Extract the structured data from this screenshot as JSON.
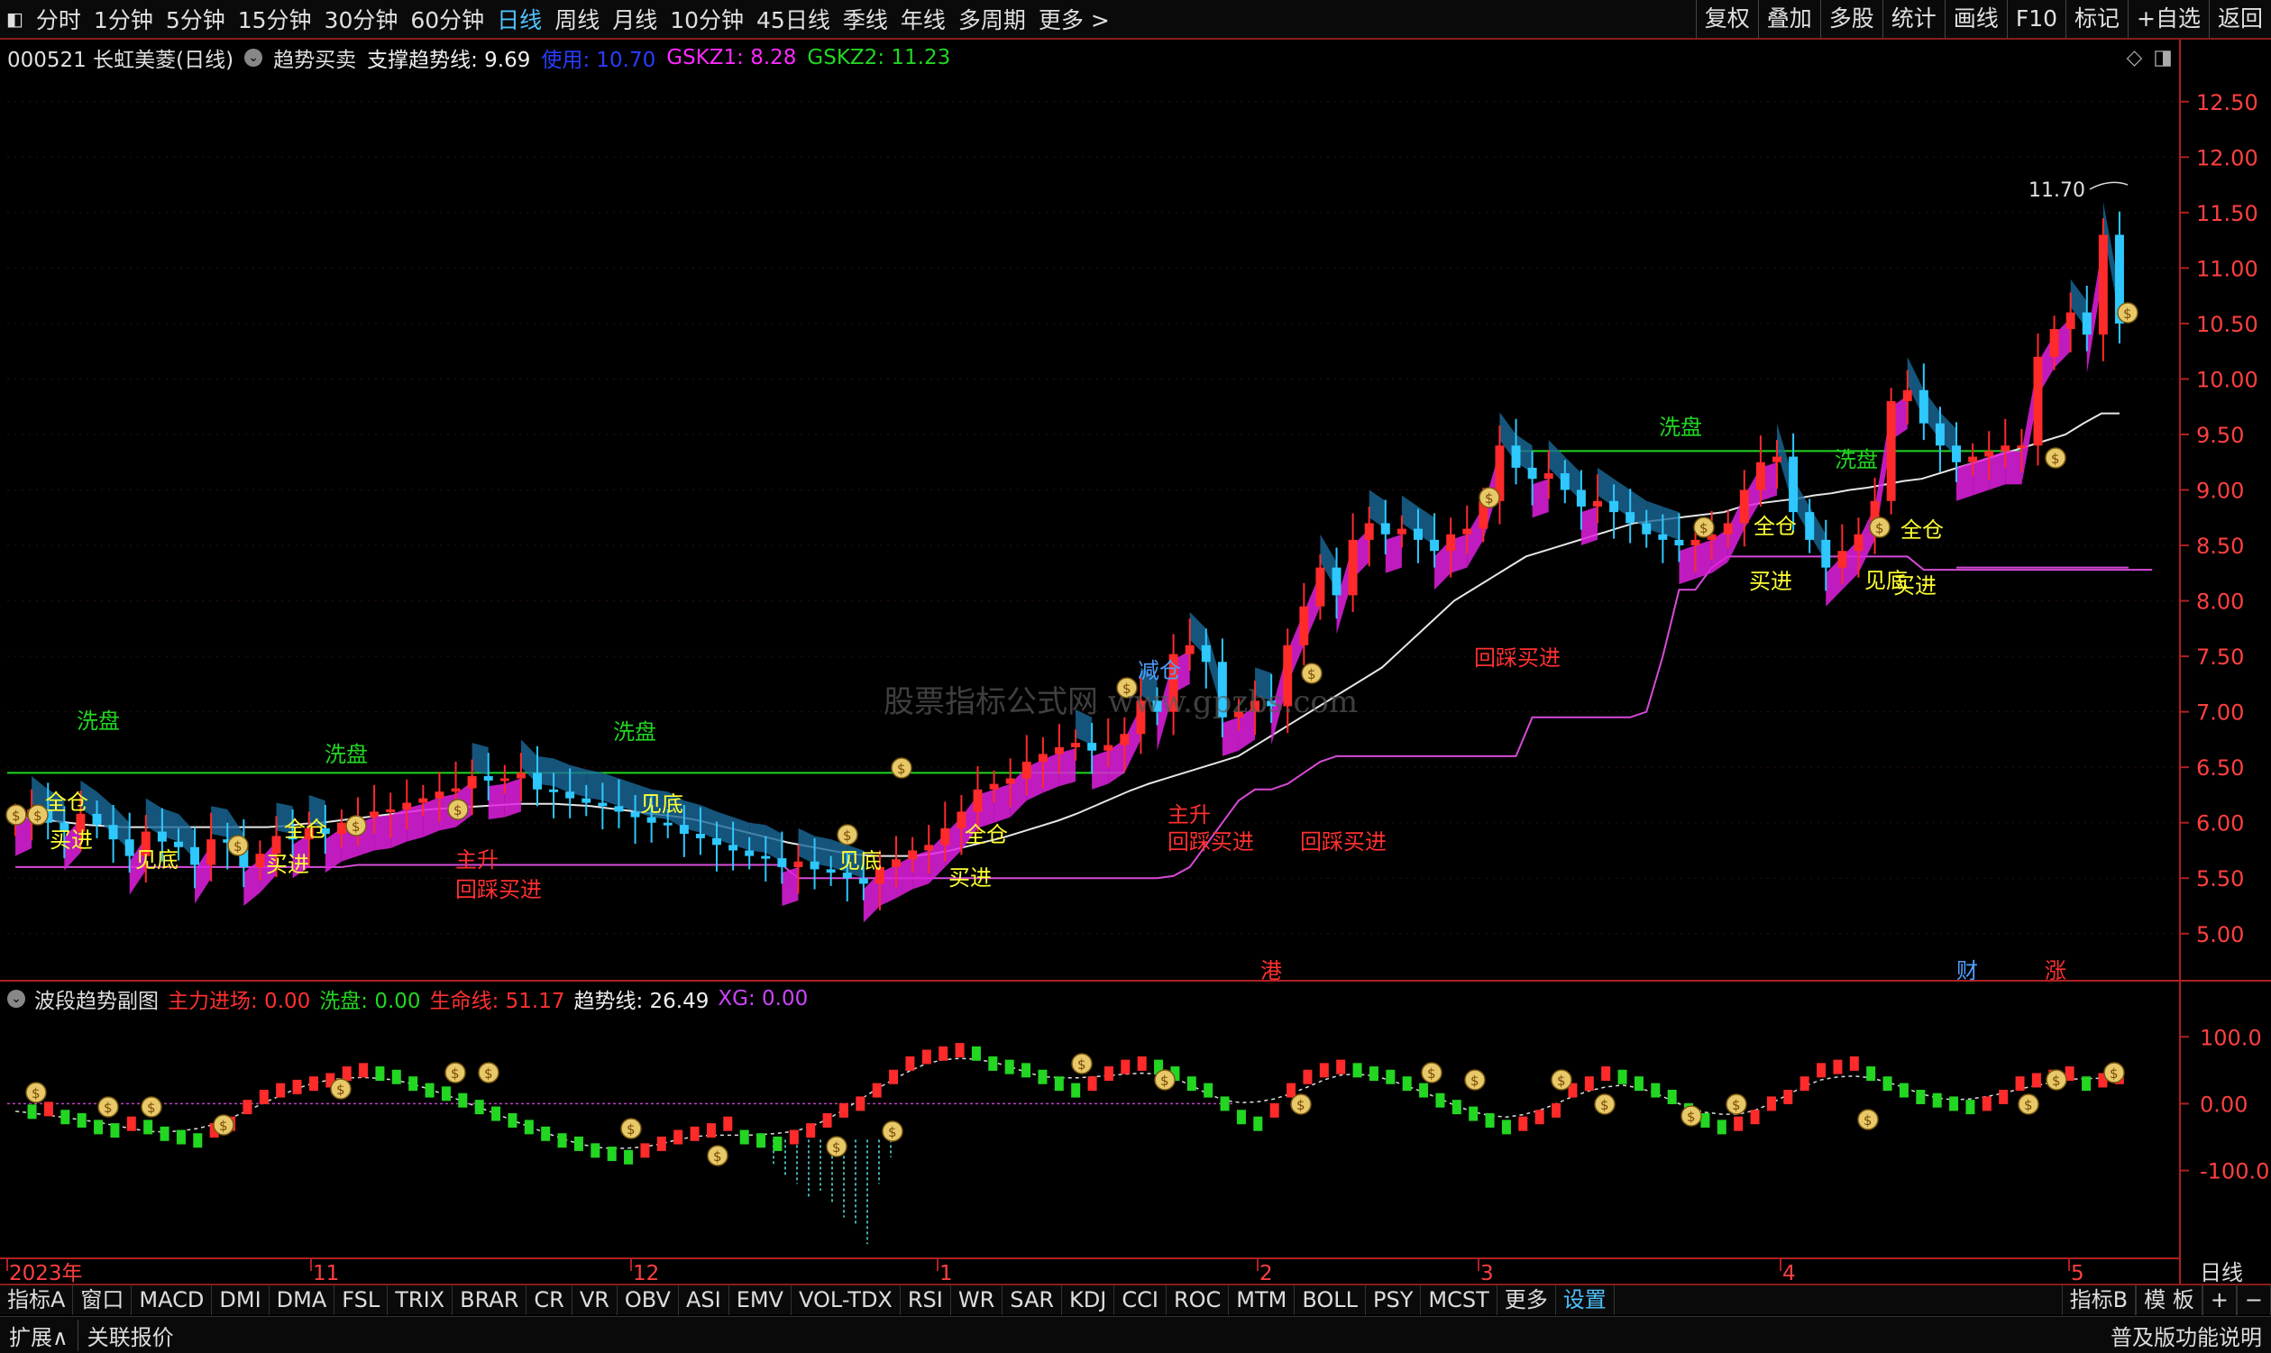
{
  "top_bar": {
    "periods": [
      "分时",
      "1分钟",
      "5分钟",
      "15分钟",
      "30分钟",
      "60分钟",
      "日线",
      "周线",
      "月线",
      "10分钟",
      "45日线",
      "季线",
      "年线",
      "多周期",
      "更多 >"
    ],
    "active": "日线",
    "tools": [
      "复权",
      "叠加",
      "多股",
      "统计",
      "画线",
      "F10",
      "标记",
      "+自选",
      "返回"
    ]
  },
  "info": {
    "stock": "000521 长虹美菱(日线)",
    "indicator": "趋势买卖",
    "support_label": "支撑趋势线: 9.69",
    "use_label": "使用: 10.70",
    "gskz1": "GSKZ1: 8.28",
    "gskz2": "GSKZ2: 11.23"
  },
  "sub_info": {
    "name": "波段趋势副图",
    "zljc": "主力进场: 0.00",
    "xp": "洗盘: 0.00",
    "smx": "生命线: 51.17",
    "qsx": "趋势线: 26.49",
    "xg": "XG: 0.00"
  },
  "colors": {
    "up": "#ff2a2a",
    "down": "#2ec8ff",
    "support": "#d84bd8",
    "ma": "#e6e6e6",
    "green": "#22d622",
    "magenta": "#ff2aff",
    "yellow": "#ffff33",
    "red_text": "#ff3030"
  },
  "watermark": "股票指标公式网 www.gpzbs.com",
  "ind_bar": {
    "items": [
      "指标A",
      "窗口",
      "MACD",
      "DMI",
      "DMA",
      "FSL",
      "TRIX",
      "BRAR",
      "CR",
      "VR",
      "OBV",
      "ASI",
      "EMV",
      "VOL-TDX",
      "RSI",
      "WR",
      "SAR",
      "KDJ",
      "CCI",
      "ROC",
      "MTM",
      "BOLL",
      "PSY",
      "MCST",
      "更多",
      "设置"
    ],
    "active": "设置",
    "right": [
      "指标B",
      "模 板",
      "+",
      "−"
    ],
    "period_tag": "日线"
  },
  "bottom_bar": {
    "left": [
      "扩展∧",
      "关联报价"
    ],
    "right": "普及版功能说明"
  },
  "chart_data": [
    {
      "type": "candlestick",
      "title": "000521 长虹美菱(日线)",
      "ylim": [
        4.6,
        12.75
      ],
      "y_ticks": [
        "12.50",
        "12.00",
        "11.50",
        "11.00",
        "10.50",
        "10.00",
        "9.50",
        "9.00",
        "8.50",
        "8.00",
        "7.50",
        "7.00",
        "6.50",
        "6.00",
        "5.50",
        "5.00"
      ],
      "x_ticks": [
        "2023年",
        "11",
        "12",
        "1",
        "2",
        "3",
        "4",
        "5"
      ],
      "close": [
        6.05,
        6.12,
        6.0,
        5.92,
        6.08,
        5.98,
        5.85,
        5.7,
        5.92,
        5.83,
        5.78,
        5.62,
        5.85,
        5.82,
        5.6,
        5.72,
        5.88,
        5.85,
        5.95,
        5.9,
        6.0,
        6.05,
        6.1,
        6.12,
        6.18,
        6.22,
        6.28,
        6.31,
        6.42,
        6.38,
        6.4,
        6.45,
        6.3,
        6.28,
        6.22,
        6.18,
        6.15,
        6.1,
        6.05,
        6.0,
        5.98,
        5.9,
        5.86,
        5.8,
        5.75,
        5.7,
        5.68,
        5.6,
        5.65,
        5.58,
        5.55,
        5.5,
        5.45,
        5.6,
        5.67,
        5.75,
        5.8,
        5.95,
        6.1,
        6.3,
        6.35,
        6.4,
        6.55,
        6.62,
        6.68,
        6.72,
        6.65,
        6.7,
        6.8,
        7.1,
        7.0,
        7.52,
        7.6,
        7.45,
        6.95,
        7.0,
        7.1,
        7.05,
        7.6,
        7.95,
        8.3,
        8.05,
        8.55,
        8.7,
        8.6,
        8.65,
        8.55,
        8.45,
        8.6,
        8.65,
        8.9,
        9.4,
        9.2,
        9.1,
        9.15,
        9.0,
        8.85,
        8.9,
        8.8,
        8.7,
        8.6,
        8.55,
        8.5,
        8.55,
        8.6,
        8.7,
        9.0,
        9.25,
        9.3,
        8.8,
        8.55,
        8.3,
        8.45,
        8.6,
        8.9,
        9.8,
        9.9,
        9.6,
        9.4,
        9.25,
        9.3,
        9.35,
        9.4,
        9.4,
        10.2,
        10.45,
        10.6,
        10.4,
        11.3,
        10.5
      ],
      "support_line": [
        5.6,
        5.6,
        5.6,
        5.6,
        5.6,
        5.6,
        5.6,
        5.6,
        5.6,
        5.6,
        5.6,
        5.6,
        5.6,
        5.6,
        5.6,
        5.6,
        5.6,
        5.6,
        5.6,
        5.6,
        5.6,
        5.62,
        5.62,
        5.62,
        5.62,
        5.62,
        5.62,
        5.62,
        5.62,
        5.62,
        5.62,
        5.62,
        5.62,
        5.62,
        5.62,
        5.62,
        5.62,
        5.62,
        5.62,
        5.62,
        5.62,
        5.62,
        5.62,
        5.62,
        5.62,
        5.62,
        5.62,
        5.62,
        5.5,
        5.5,
        5.5,
        5.5,
        5.5,
        5.5,
        5.5,
        5.5,
        5.5,
        5.5,
        5.5,
        5.5,
        5.5,
        5.5,
        5.5,
        5.5,
        5.5,
        5.5,
        5.5,
        5.5,
        5.5,
        5.5,
        5.5,
        5.52,
        5.6,
        5.8,
        6.0,
        6.2,
        6.3,
        6.3,
        6.35,
        6.45,
        6.55,
        6.6,
        6.6,
        6.6,
        6.6,
        6.6,
        6.6,
        6.6,
        6.6,
        6.6,
        6.6,
        6.6,
        6.6,
        6.95,
        6.95,
        6.95,
        6.95,
        6.95,
        6.95,
        6.95,
        7.0,
        7.5,
        8.1,
        8.1,
        8.3,
        8.4,
        8.4,
        8.4,
        8.4,
        8.4,
        8.4,
        8.4,
        8.4,
        8.4,
        8.4,
        8.4,
        8.4,
        8.28,
        8.28,
        8.28,
        8.28,
        8.28,
        8.28,
        8.28,
        8.28,
        8.28,
        8.28,
        8.28,
        8.28,
        8.28,
        8.28,
        8.28
      ],
      "ma_line": [
        6.05,
        6.04,
        6.02,
        6.0,
        5.98,
        5.97,
        5.96,
        5.96,
        5.96,
        5.96,
        5.96,
        5.96,
        5.96,
        5.96,
        5.96,
        5.97,
        5.99,
        6.0,
        6.02,
        6.04,
        6.06,
        6.08,
        6.1,
        6.12,
        6.13,
        6.14,
        6.15,
        6.16,
        6.17,
        6.17,
        6.17,
        6.16,
        6.15,
        6.13,
        6.11,
        6.09,
        6.07,
        6.05,
        6.02,
        5.98,
        5.94,
        5.9,
        5.86,
        5.82,
        5.79,
        5.76,
        5.73,
        5.71,
        5.7,
        5.7,
        5.7,
        5.72,
        5.75,
        5.79,
        5.83,
        5.87,
        5.92,
        5.97,
        6.02,
        6.08,
        6.15,
        6.22,
        6.29,
        6.35,
        6.4,
        6.45,
        6.5,
        6.55,
        6.6,
        6.7,
        6.8,
        6.9,
        7.0,
        7.1,
        7.2,
        7.3,
        7.4,
        7.55,
        7.7,
        7.85,
        8.0,
        8.1,
        8.2,
        8.3,
        8.4,
        8.45,
        8.5,
        8.55,
        8.6,
        8.65,
        8.7,
        8.72,
        8.74,
        8.76,
        8.78,
        8.8,
        8.85,
        8.88,
        8.9,
        8.92,
        8.95,
        8.97,
        9.0,
        9.02,
        9.05,
        9.08,
        9.1,
        9.15,
        9.2,
        9.25,
        9.3,
        9.35,
        9.4,
        9.45,
        9.5,
        9.6,
        9.69,
        9.69
      ],
      "last_price_label": "11.70",
      "level_lines": [
        {
          "label": "洗盘",
          "value": 6.45
        },
        {
          "label": "洗盘",
          "value": 9.35
        },
        {
          "label": "回踩",
          "value": 8.3
        }
      ],
      "annotations": [
        {
          "text": "洗盘",
          "color": "green"
        },
        {
          "text": "买进",
          "color": "yellow"
        },
        {
          "text": "见底",
          "color": "yellow"
        },
        {
          "text": "全仓",
          "color": "yellow"
        },
        {
          "text": "主升",
          "color": "red"
        },
        {
          "text": "回踩买进",
          "color": "red"
        },
        {
          "text": "减仓",
          "color": "blue"
        },
        {
          "text": "港",
          "color": "red"
        },
        {
          "text": "财",
          "color": "blue"
        },
        {
          "text": "涨",
          "color": "red"
        }
      ]
    },
    {
      "type": "bar",
      "title": "波段趋势副图",
      "ylim": [
        -230,
        130
      ],
      "y_ticks": [
        "100.0",
        "0.00",
        "-100.0"
      ],
      "main": [
        -5,
        -12,
        -8,
        -20,
        -25,
        -35,
        -40,
        -30,
        -35,
        -45,
        -50,
        -55,
        -40,
        -30,
        -5,
        10,
        20,
        25,
        30,
        35,
        45,
        50,
        45,
        40,
        30,
        20,
        15,
        5,
        -5,
        -15,
        -25,
        -35,
        -45,
        -55,
        -60,
        -70,
        -75,
        -80,
        -70,
        -60,
        -50,
        -45,
        -40,
        -30,
        -50,
        -55,
        -60,
        -50,
        -40,
        -25,
        -10,
        0,
        20,
        40,
        60,
        70,
        75,
        80,
        75,
        60,
        55,
        50,
        40,
        30,
        20,
        30,
        45,
        55,
        60,
        55,
        45,
        30,
        20,
        0,
        -20,
        -30,
        -10,
        20,
        40,
        50,
        55,
        50,
        45,
        40,
        30,
        20,
        5,
        -5,
        -15,
        -25,
        -35,
        -30,
        -20,
        -10,
        20,
        30,
        45,
        40,
        30,
        20,
        10,
        -10,
        -25,
        -35,
        -30,
        -20,
        0,
        10,
        30,
        50,
        55,
        60,
        45,
        30,
        20,
        10,
        5,
        0,
        -5,
        0,
        10,
        30,
        35,
        40,
        45,
        30,
        35,
        40
      ],
      "neg_hist": [
        -60,
        -90,
        -110,
        -120,
        -140,
        -130,
        -150,
        -170,
        -180,
        -210,
        -120,
        -80
      ]
    }
  ]
}
